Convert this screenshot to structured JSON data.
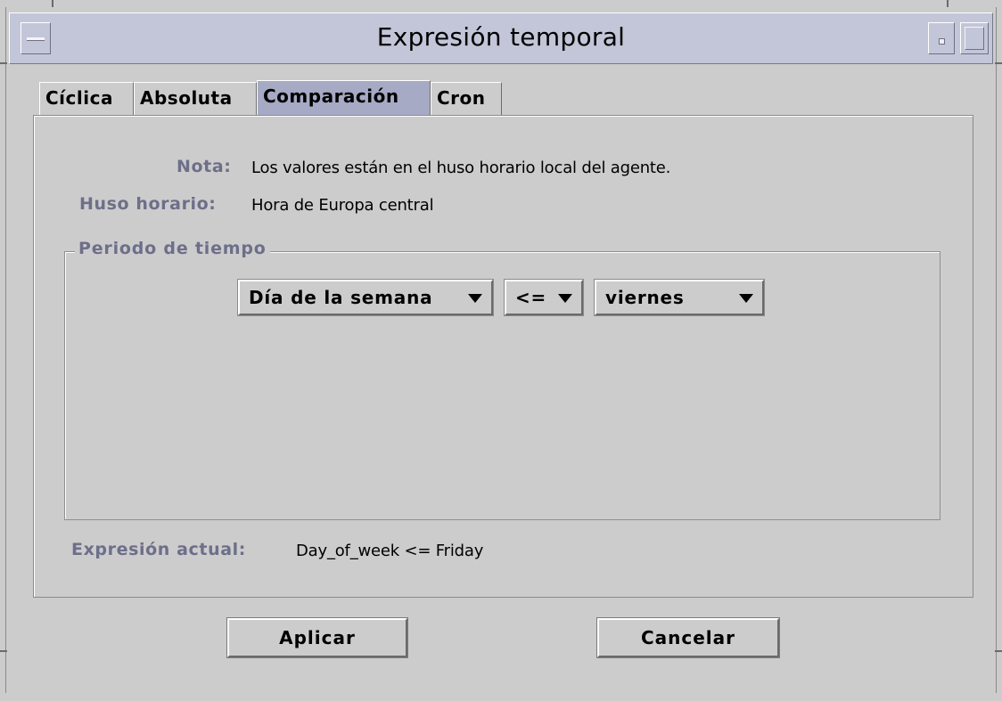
{
  "window": {
    "title": "Expresión temporal"
  },
  "tabs": [
    {
      "label": "Cíclica",
      "active": false
    },
    {
      "label": "Absoluta",
      "active": false
    },
    {
      "label": "Comparación",
      "active": true
    },
    {
      "label": "Cron",
      "active": false
    }
  ],
  "info": {
    "note_label": "Nota:",
    "note_value": "Los valores están en el huso horario local del agente.",
    "timezone_label": "Huso horario:",
    "timezone_value": "Hora de Europa central"
  },
  "period": {
    "title": "Periodo de tiempo",
    "field_select": "Día de la semana",
    "operator_select": "<=",
    "value_select": "viernes"
  },
  "expression": {
    "label": "Expresión actual:",
    "value": "Day_of_week <= Friday"
  },
  "buttons": {
    "apply": "Aplicar",
    "cancel": "Cancelar"
  },
  "colors": {
    "titlebar": "#c3c6d8",
    "active_tab": "#a6aac4",
    "label_text": "#6d6f8a",
    "background": "#cccccc"
  }
}
